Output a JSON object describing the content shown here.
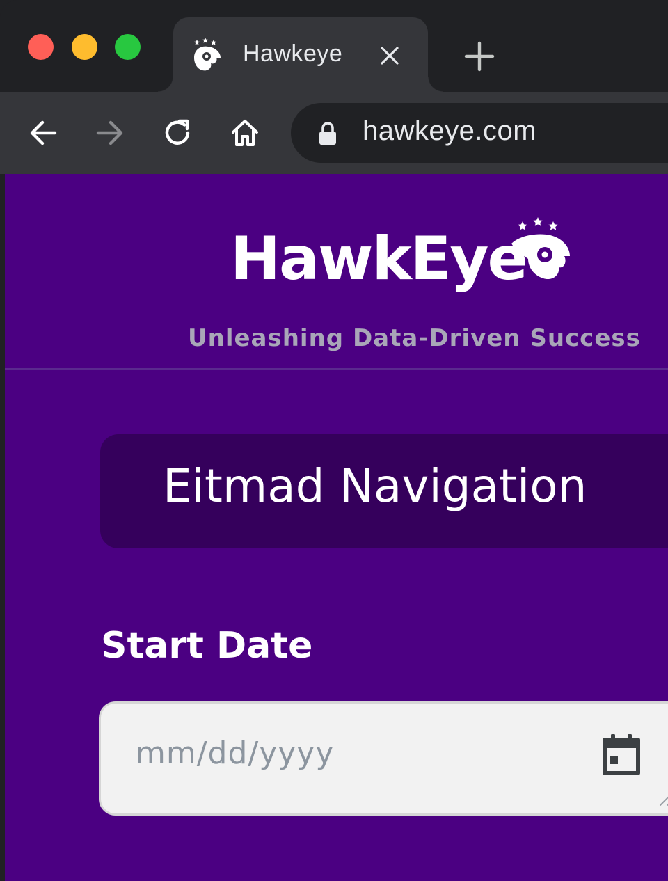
{
  "browser": {
    "tab": {
      "title": "Hawkeye",
      "favicon": "hawk-logo-icon"
    },
    "address_bar": {
      "url": "hawkeye.com",
      "lock": "lock-icon"
    },
    "controls": [
      "back-icon",
      "forward-icon",
      "reload-icon",
      "home-icon"
    ],
    "new_tab": "plus-icon",
    "traffic_lights": {
      "close": "#ff5f57",
      "minimize": "#febc2e",
      "zoom": "#28c840"
    }
  },
  "page": {
    "logo_text": "HawkEye",
    "tagline": "Unleashing Data-Driven Success",
    "nav_title": "Eitmad Navigation",
    "start_date": {
      "label": "Start Date",
      "placeholder": "mm/dd/yyyy",
      "value": "",
      "icon": "calendar-icon"
    }
  },
  "colors": {
    "page_bg": "#4b0082",
    "nav_card_bg": "#35005c",
    "tagline": "#a9a6b8",
    "input_bg": "#f2f2f2"
  }
}
